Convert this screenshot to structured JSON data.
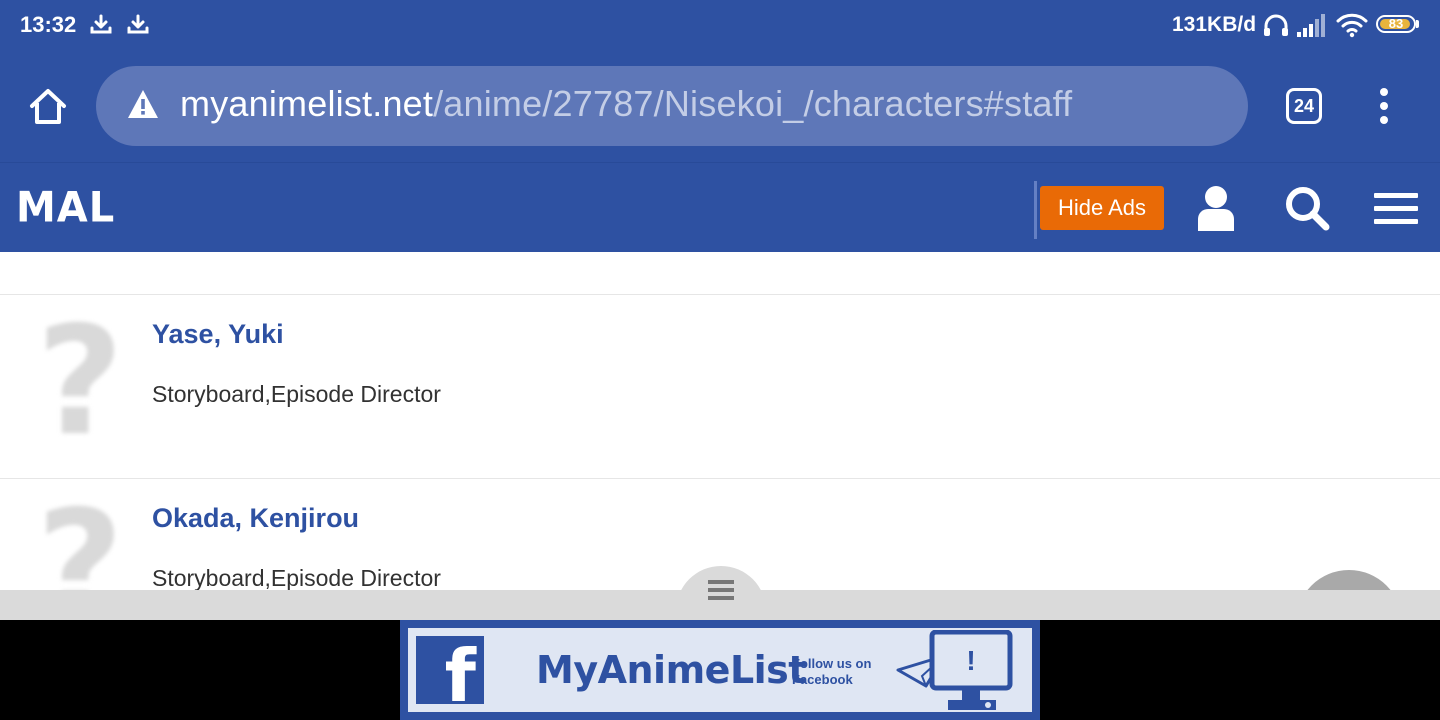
{
  "status_bar": {
    "time": "13:32",
    "network_speed": "131KB/d",
    "battery_level": "83",
    "icons": [
      "download-icon",
      "download-icon",
      "headphones-icon",
      "signal-icon",
      "wifi-icon",
      "battery-icon"
    ]
  },
  "browser": {
    "url_domain": "myanimelist.net",
    "url_path": "/anime/27787/Nisekoi_/characters#staff",
    "tab_count": "24",
    "icons": [
      "home-icon",
      "warning-icon",
      "tabs-icon",
      "overflow-menu-icon"
    ]
  },
  "site_header": {
    "logo_text": "MAL",
    "hide_ads_label": "Hide Ads",
    "icons": [
      "user-icon",
      "search-icon",
      "hamburger-menu-icon"
    ],
    "brand_color": "#2e51a2",
    "accent_color": "#e96a06"
  },
  "staff": [
    {
      "name": "Yase, Yuki",
      "role": "Storyboard,Episode Director",
      "avatar": "?"
    },
    {
      "name": "Okada, Kenjirou",
      "role": "Storyboard,Episode Director",
      "avatar": "?"
    }
  ],
  "ad_banner": {
    "fb_letter": "f",
    "brand": "MyAnimeList",
    "follow_line1": "Follow us on",
    "follow_line2": "Facebook",
    "screen_mark": "!"
  }
}
